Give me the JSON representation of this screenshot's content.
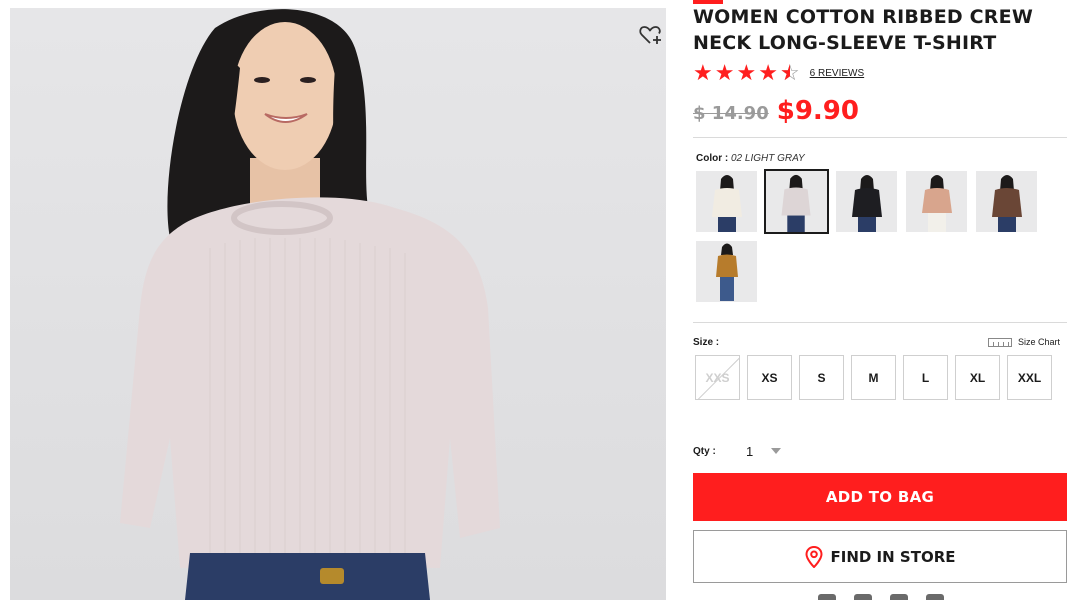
{
  "product": {
    "title": "WOMEN COTTON RIBBED CREW NECK LONG-SLEEVE T-SHIRT",
    "rating": 4.5,
    "reviews_label": "6 REVIEWS",
    "original_price": "$ 14.90",
    "sale_price": "$9.90",
    "brand_color": "#ff1e1e"
  },
  "color": {
    "label": "Color :",
    "selected": "02 LIGHT GRAY",
    "swatches": [
      {
        "name": "off-white",
        "hex": "#f1ece2"
      },
      {
        "name": "light-gray",
        "hex": "#ddd5d6"
      },
      {
        "name": "black",
        "hex": "#1e1e22"
      },
      {
        "name": "pink",
        "hex": "#d8a58d"
      },
      {
        "name": "brown",
        "hex": "#6a4636"
      },
      {
        "name": "mustard",
        "hex": "#b77c2c"
      }
    ],
    "selected_index": 1
  },
  "size": {
    "label": "Size :",
    "chart_label": "Size Chart",
    "options": [
      {
        "label": "XXS",
        "available": false
      },
      {
        "label": "XS",
        "available": true
      },
      {
        "label": "S",
        "available": true
      },
      {
        "label": "M",
        "available": true
      },
      {
        "label": "L",
        "available": true
      },
      {
        "label": "XL",
        "available": true
      },
      {
        "label": "XXL",
        "available": true
      }
    ]
  },
  "quantity": {
    "label": "Qty :",
    "value": "1"
  },
  "actions": {
    "add_to_bag": "ADD TO BAG",
    "find_in_store": "FIND IN STORE"
  },
  "icons": {
    "wishlist": "heart-plus-icon",
    "star": "star-icon",
    "location": "map-pin-icon",
    "ruler": "ruler-icon"
  }
}
